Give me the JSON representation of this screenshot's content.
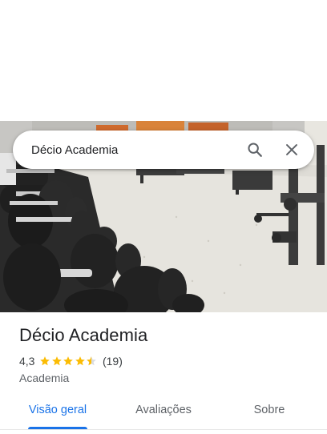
{
  "search": {
    "query": "Décio Academia",
    "search_icon": "search-icon",
    "close_icon": "close-icon"
  },
  "place": {
    "name": "Décio Academia",
    "rating": "4,3",
    "rating_value": 4.3,
    "rating_max": 5,
    "review_count": "(19)",
    "category": "Academia",
    "photo": "gym-photo"
  },
  "tabs": [
    {
      "label": "Visão geral",
      "active": true
    },
    {
      "label": "Avaliações",
      "active": false
    },
    {
      "label": "Sobre",
      "active": false
    }
  ],
  "colors": {
    "accent": "#1a73e8",
    "star": "#fbbc04",
    "text": "#202124",
    "muted": "#5f6368"
  }
}
